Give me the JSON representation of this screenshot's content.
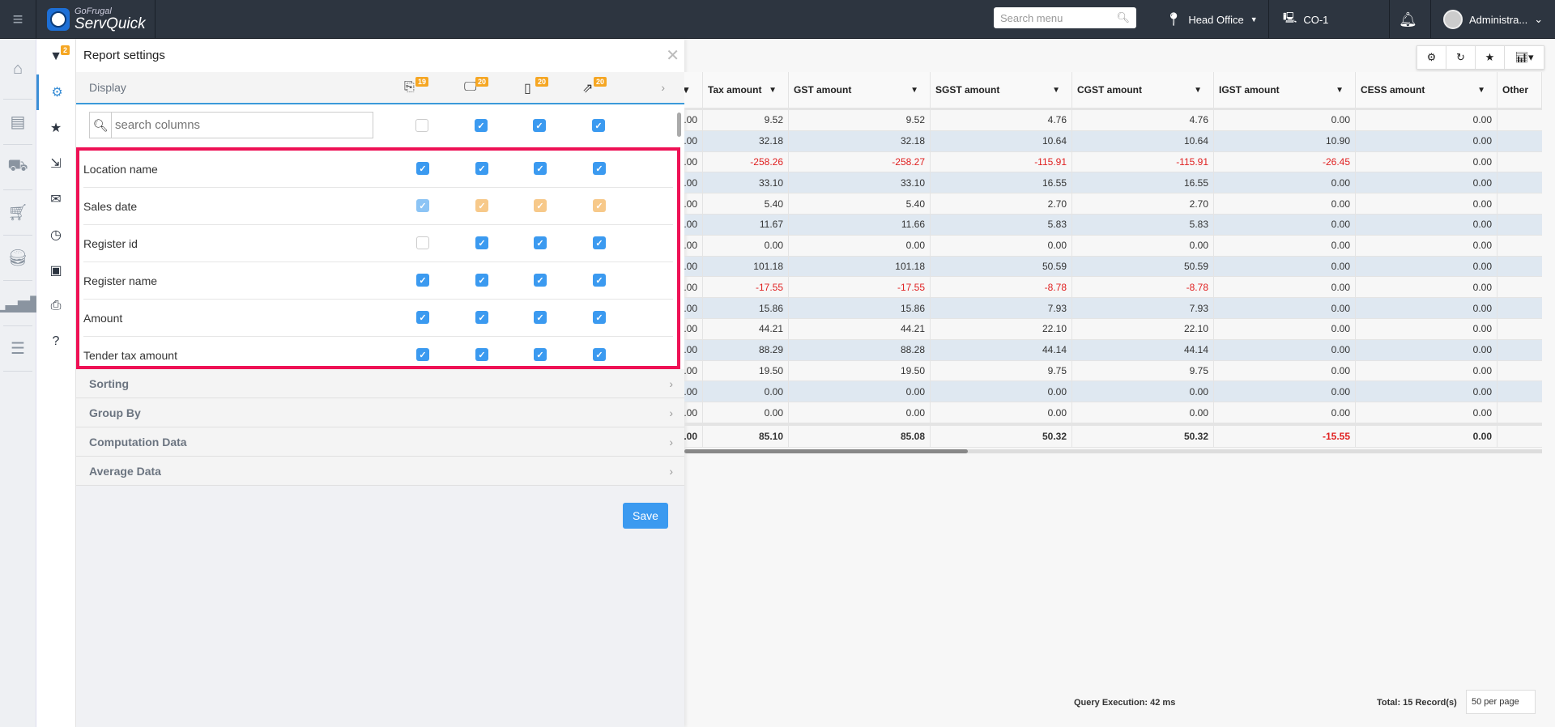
{
  "header": {
    "logo_small": "GoFrugal",
    "logo_big": "ServQuick",
    "search_placeholder": "Search menu",
    "location": "Head Office",
    "register": "CO-1",
    "user": "Administra..."
  },
  "panel": {
    "title": "Report settings",
    "filter_badge": "2",
    "display_label": "Display",
    "column_counts": [
      "19",
      "20",
      "20",
      "20"
    ],
    "search_placeholder": "search columns",
    "header_checks": [
      "off",
      "on",
      "on",
      "on"
    ],
    "rows": [
      {
        "label": "Location name",
        "checks": [
          "on",
          "on",
          "on",
          "on"
        ]
      },
      {
        "label": "Sales date",
        "checks": [
          "lt",
          "or",
          "or",
          "or"
        ]
      },
      {
        "label": "Register id",
        "checks": [
          "off",
          "on",
          "on",
          "on"
        ]
      },
      {
        "label": "Register name",
        "checks": [
          "on",
          "on",
          "on",
          "on"
        ]
      },
      {
        "label": "Amount",
        "checks": [
          "on",
          "on",
          "on",
          "on"
        ]
      },
      {
        "label": "Tender tax amount",
        "checks": [
          "on",
          "on",
          "on",
          "on"
        ]
      }
    ],
    "sections": [
      "Sorting",
      "Group By",
      "Computation Data",
      "Average Data"
    ],
    "save": "Save"
  },
  "table": {
    "columns": [
      "",
      "Tax amount",
      "GST amount",
      "SGST amount",
      "CGST amount",
      "IGST amount",
      "CESS amount",
      "Other"
    ],
    "rows": [
      [
        ".00",
        "9.52",
        "9.52",
        "4.76",
        "4.76",
        "0.00",
        "0.00"
      ],
      [
        ".00",
        "32.18",
        "32.18",
        "10.64",
        "10.64",
        "10.90",
        "0.00"
      ],
      [
        ".00",
        "-258.26",
        "-258.27",
        "-115.91",
        "-115.91",
        "-26.45",
        "0.00"
      ],
      [
        ".00",
        "33.10",
        "33.10",
        "16.55",
        "16.55",
        "0.00",
        "0.00"
      ],
      [
        ".00",
        "5.40",
        "5.40",
        "2.70",
        "2.70",
        "0.00",
        "0.00"
      ],
      [
        ".00",
        "11.67",
        "11.66",
        "5.83",
        "5.83",
        "0.00",
        "0.00"
      ],
      [
        ".00",
        "0.00",
        "0.00",
        "0.00",
        "0.00",
        "0.00",
        "0.00"
      ],
      [
        ".00",
        "101.18",
        "101.18",
        "50.59",
        "50.59",
        "0.00",
        "0.00"
      ],
      [
        ".00",
        "-17.55",
        "-17.55",
        "-8.78",
        "-8.78",
        "0.00",
        "0.00"
      ],
      [
        ".00",
        "15.86",
        "15.86",
        "7.93",
        "7.93",
        "0.00",
        "0.00"
      ],
      [
        ".00",
        "44.21",
        "44.21",
        "22.10",
        "22.10",
        "0.00",
        "0.00"
      ],
      [
        ".00",
        "88.29",
        "88.28",
        "44.14",
        "44.14",
        "0.00",
        "0.00"
      ],
      [
        ".00",
        "19.50",
        "19.50",
        "9.75",
        "9.75",
        "0.00",
        "0.00"
      ],
      [
        ".00",
        "0.00",
        "0.00",
        "0.00",
        "0.00",
        "0.00",
        "0.00"
      ],
      [
        ".00",
        "0.00",
        "0.00",
        "0.00",
        "0.00",
        "0.00",
        "0.00"
      ]
    ],
    "totals": [
      ".00",
      "85.10",
      "85.08",
      "50.32",
      "50.32",
      "-15.55",
      "0.00"
    ]
  },
  "footer": {
    "query": "Query Execution: 42 ms",
    "total": "Total: 15 Record(s)",
    "per_page": "50 per page"
  }
}
